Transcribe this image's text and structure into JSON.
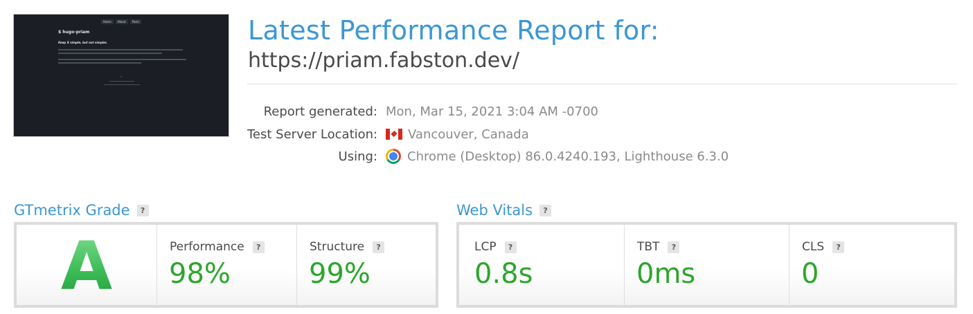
{
  "thumbnail": {
    "nav": [
      "Home",
      "About",
      "Posts"
    ],
    "site_title": "$ hugo-priam",
    "tagline": "Keep it simple, but not simpler."
  },
  "header": {
    "title": "Latest Performance Report for:",
    "url": "https://priam.fabston.dev/"
  },
  "meta": {
    "generated_label": "Report generated:",
    "generated_value": "Mon, Mar 15, 2021 3:04 AM -0700",
    "location_label": "Test Server Location:",
    "location_value": "Vancouver, Canada",
    "location_icon": "canada-flag-icon",
    "using_label": "Using:",
    "using_value": "Chrome (Desktop) 86.0.4240.193, Lighthouse 6.3.0",
    "using_icon": "chrome-icon"
  },
  "grade": {
    "section_title": "GTmetrix Grade",
    "help": "?",
    "letter": "A",
    "performance_label": "Performance",
    "performance_value": "98%",
    "structure_label": "Structure",
    "structure_value": "99%"
  },
  "vitals": {
    "section_title": "Web Vitals",
    "help": "?",
    "lcp_label": "LCP",
    "lcp_value": "0.8s",
    "tbt_label": "TBT",
    "tbt_value": "0ms",
    "cls_label": "CLS",
    "cls_value": "0"
  },
  "colors": {
    "accent": "#3b97d3",
    "good": "#2ca62c",
    "grade_a": "#3dbd58"
  }
}
